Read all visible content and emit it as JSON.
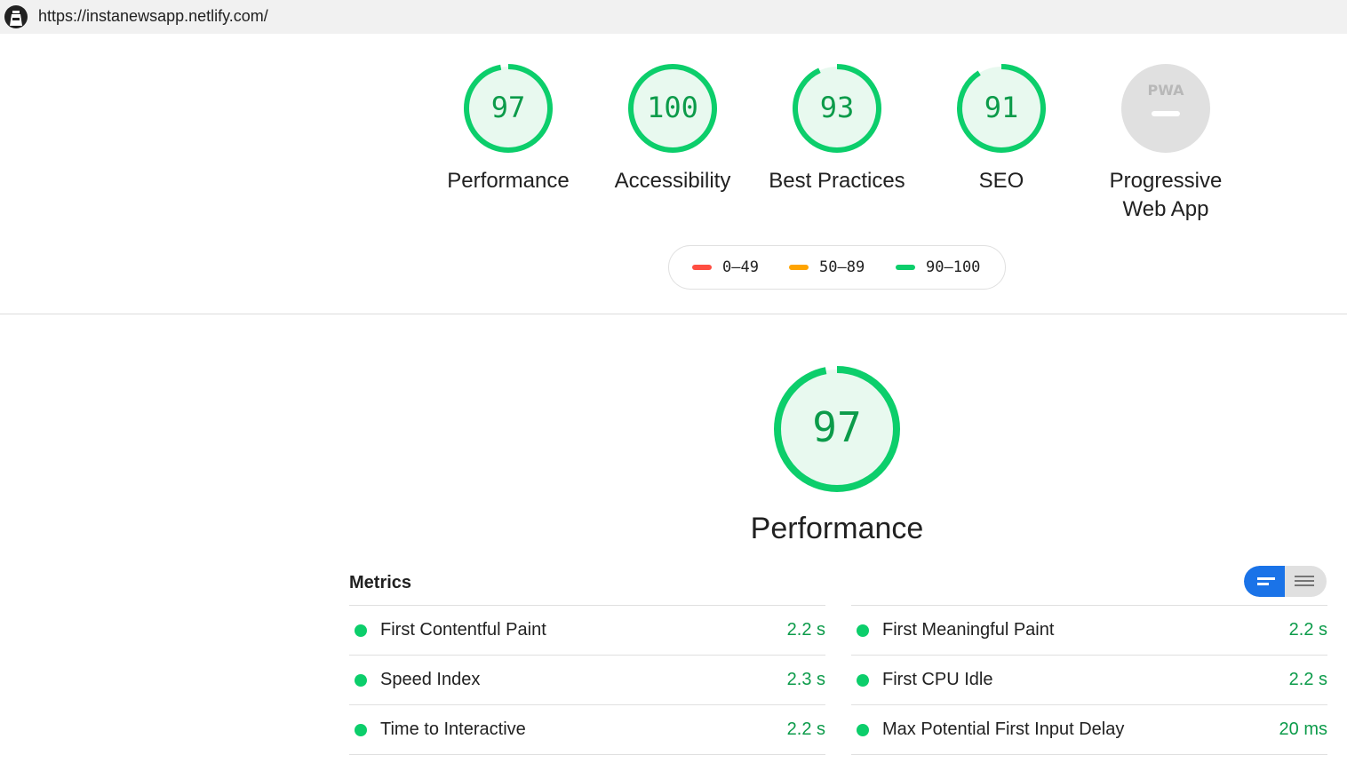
{
  "browser": {
    "url": "https://instanewsapp.netlify.com/"
  },
  "colors": {
    "pass": "#0cce6b",
    "pass_text": "#0c9b4a",
    "average": "#ffa400",
    "fail": "#ff4e42",
    "na": "#e0e0e0",
    "toggle_active": "#1a73e8"
  },
  "categories": [
    {
      "score": "97",
      "score_fraction": 0.97,
      "label": "Performance"
    },
    {
      "score": "100",
      "score_fraction": 1.0,
      "label": "Accessibility"
    },
    {
      "score": "93",
      "score_fraction": 0.93,
      "label": "Best Practices"
    },
    {
      "score": "91",
      "score_fraction": 0.91,
      "label": "SEO"
    },
    {
      "score": "",
      "label_line1": "Progressive",
      "label_line2": "Web App",
      "badge_text": "PWA"
    }
  ],
  "legend": [
    {
      "range": "0–49",
      "color": "#ff4e42"
    },
    {
      "range": "50–89",
      "color": "#ffa400"
    },
    {
      "range": "90–100",
      "color": "#0cce6b"
    }
  ],
  "performance": {
    "score": "97",
    "score_fraction": 0.97,
    "title": "Performance",
    "metrics_heading": "Metrics",
    "metrics_left": [
      {
        "name": "First Contentful Paint",
        "value": "2.2 s"
      },
      {
        "name": "Speed Index",
        "value": "2.3 s"
      },
      {
        "name": "Time to Interactive",
        "value": "2.2 s"
      }
    ],
    "metrics_right": [
      {
        "name": "First Meaningful Paint",
        "value": "2.2 s"
      },
      {
        "name": "First CPU Idle",
        "value": "2.2 s"
      },
      {
        "name": "Max Potential First Input Delay",
        "value": "20 ms"
      }
    ]
  },
  "icons": {
    "logo": "lighthouse-icon",
    "view_toggle_compact": "compact-view-icon",
    "view_toggle_list": "list-view-icon"
  }
}
